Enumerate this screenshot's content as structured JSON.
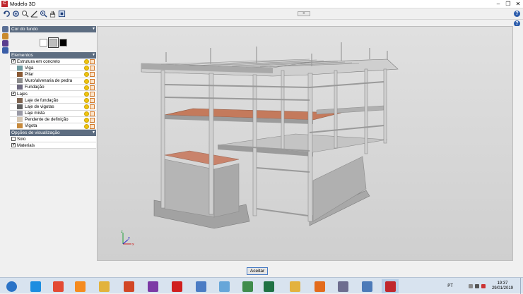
{
  "window": {
    "title": "Modelo 3D",
    "app_icon": "cypecad-icon"
  },
  "toolbar": {
    "buttons": [
      "rotate-icon",
      "orbit-icon",
      "zoom-window-icon",
      "measure-icon",
      "zoom-in-icon",
      "pan-hand-icon",
      "fit-view-icon"
    ],
    "grip": "≡"
  },
  "panel": {
    "background_section": {
      "title": "Cor do fundo",
      "swatches": [
        "#ffffff",
        "#bdbdbd",
        "#000000"
      ],
      "selected": 1
    },
    "elements_section": {
      "title": "Elementos",
      "groups": [
        {
          "label": "Estrutura em concreto",
          "checked": true,
          "items": [
            {
              "label": "Viga",
              "color": "#6f9aa0"
            },
            {
              "label": "Pilar",
              "color": "#8a5a35"
            },
            {
              "label": "Muro/alvenaria de pedra",
              "color": "#8d8d8d"
            },
            {
              "label": "Fundação",
              "color": "#6e6a80"
            }
          ]
        },
        {
          "label": "Lajes",
          "checked": true,
          "items": [
            {
              "label": "Laje de fundação",
              "color": "#7e6450"
            },
            {
              "label": "Laje de vigotas",
              "color": "#5f5f5f"
            },
            {
              "label": "Laje mista",
              "color": "#9a9aa6"
            },
            {
              "label": "Pendente de definição",
              "color": "#d5c7b4"
            },
            {
              "label": "Vigota",
              "color": "#c88a3c"
            }
          ]
        }
      ]
    },
    "view_section": {
      "title": "Opções de visualização",
      "options": [
        {
          "label": "Solo",
          "checked": false
        },
        {
          "label": "Materiais",
          "checked": true
        }
      ]
    }
  },
  "viewport": {
    "axes": {
      "x": "x",
      "y": "y",
      "z": "z"
    }
  },
  "footer": {
    "accept_label": "Aceitar"
  },
  "taskbar": {
    "apps": [
      {
        "name": "start-icon",
        "color": "#2a73c7"
      },
      {
        "name": "internet-explorer-icon",
        "color": "#1c8de0"
      },
      {
        "name": "chrome-icon",
        "color": "#e34a34"
      },
      {
        "name": "media-player-icon",
        "color": "#f58b1f"
      },
      {
        "name": "explorer-icon",
        "color": "#e2b33c"
      },
      {
        "name": "powerpoint-icon",
        "color": "#d24726"
      },
      {
        "name": "app-icon",
        "color": "#7c3aa5"
      },
      {
        "name": "acrobat-icon",
        "color": "#d01f1f"
      },
      {
        "name": "document-icon",
        "color": "#4b7cc4"
      },
      {
        "name": "notepad-icon",
        "color": "#67a6d9"
      },
      {
        "name": "calculator-icon",
        "color": "#3f8c4c"
      },
      {
        "name": "excel-icon",
        "color": "#1f7244"
      },
      {
        "name": "folder-icon",
        "color": "#e3b23f"
      },
      {
        "name": "firefox-icon",
        "color": "#e36b1c"
      },
      {
        "name": "settings-icon",
        "color": "#6d6d8f"
      },
      {
        "name": "display-icon",
        "color": "#4c7ab8"
      },
      {
        "name": "cypecad-icon",
        "color": "#c0272d"
      }
    ],
    "language": "PT",
    "time": "19:37",
    "date": "29/01/2019"
  }
}
